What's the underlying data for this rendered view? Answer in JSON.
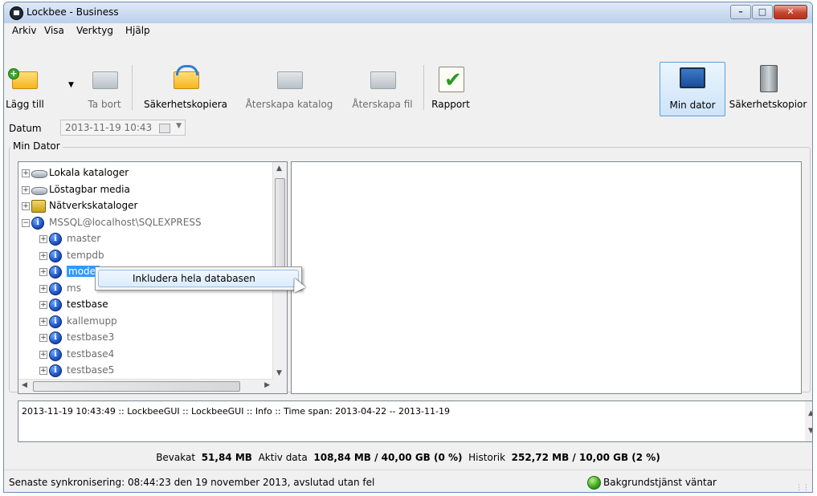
{
  "window": {
    "title": "Lockbee - Business"
  },
  "menu": [
    "Arkiv",
    "Visa",
    "Verktyg",
    "Hjälp"
  ],
  "toolbar": {
    "add": "Lägg till",
    "remove": "Ta bort",
    "backup": "Säkerhetskopiera",
    "restore_dir": "Återskapa katalog",
    "restore_file": "Återskapa fil",
    "report": "Rapport",
    "my_computer": "Min dator",
    "backups": "Säkerhetskopior"
  },
  "date": {
    "label": "Datum",
    "value": "2013-11-19 10:43"
  },
  "group_label": "Min Dator",
  "tree": [
    {
      "label": "Lokala kataloger",
      "icon": "disk-icon",
      "level": 0,
      "expanded": false,
      "gray": false
    },
    {
      "label": "Löstagbar media",
      "icon": "disk-icon",
      "level": 0,
      "expanded": false,
      "gray": false
    },
    {
      "label": "Nätverkskataloger",
      "icon": "network-icon",
      "level": 0,
      "expanded": false,
      "gray": false
    },
    {
      "label": "MSSQL@localhost\\SQLEXPRESS",
      "icon": "database-icon",
      "level": 0,
      "expanded": true,
      "gray": true
    },
    {
      "label": "master",
      "icon": "database-icon",
      "level": 1,
      "expanded": false,
      "gray": true
    },
    {
      "label": "tempdb",
      "icon": "database-icon",
      "level": 1,
      "expanded": false,
      "gray": true
    },
    {
      "label": "model",
      "icon": "database-icon",
      "level": 1,
      "expanded": false,
      "gray": false,
      "selected": true
    },
    {
      "label": "ms",
      "icon": "database-icon",
      "level": 1,
      "expanded": false,
      "gray": true
    },
    {
      "label": "testbase",
      "icon": "database-icon",
      "level": 1,
      "expanded": false,
      "gray": false
    },
    {
      "label": "kallemupp",
      "icon": "database-icon",
      "level": 1,
      "expanded": false,
      "gray": true
    },
    {
      "label": "testbase3",
      "icon": "database-icon",
      "level": 1,
      "expanded": false,
      "gray": true
    },
    {
      "label": "testbase4",
      "icon": "database-icon",
      "level": 1,
      "expanded": false,
      "gray": true
    },
    {
      "label": "testbase5",
      "icon": "database-icon",
      "level": 1,
      "expanded": false,
      "gray": true
    }
  ],
  "context_menu": {
    "item": "Inkludera hela databasen"
  },
  "log": {
    "line": "2013-11-19 10:43:49 :: LockbeeGUI :: LockbeeGUI :: Info :: Time span: 2013-04-22 -- 2013-11-19"
  },
  "stats": {
    "guarded_label": "Bevakat",
    "guarded_value": "51,84 MB",
    "active_label": "Aktiv data",
    "active_value": "108,84 MB / 40,00 GB (0 %)",
    "history_label": "Historik",
    "history_value": "252,72 MB / 10,00 GB (2 %)"
  },
  "status": {
    "left": "Senaste synkronisering: 08:44:23 den 19 november 2013, avslutad utan fel",
    "right": "Bakgrundstjänst väntar"
  }
}
